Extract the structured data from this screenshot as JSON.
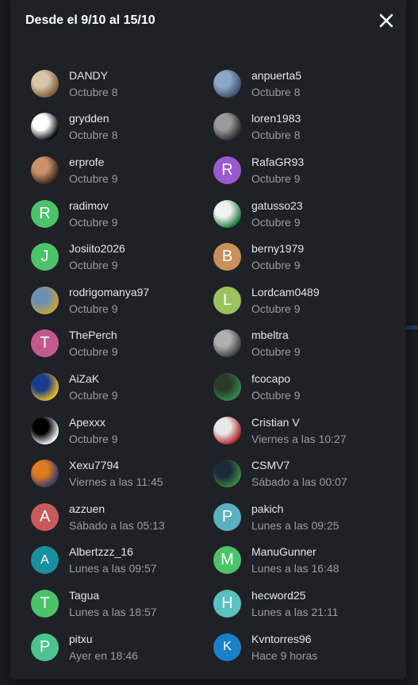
{
  "modal": {
    "title": "Desde el 9/10 al 15/10",
    "close_icon": "close-icon"
  },
  "users": [
    {
      "name": "DANDY",
      "date": "Octubre 8",
      "avatar": {
        "type": "photo",
        "colors": [
          "#d9c6a6",
          "#7a5a3a"
        ]
      }
    },
    {
      "name": "anpuerta5",
      "date": "Octubre 8",
      "avatar": {
        "type": "photo",
        "colors": [
          "#8fa6c4",
          "#3a4f70"
        ]
      }
    },
    {
      "name": "grydden",
      "date": "Octubre 8",
      "avatar": {
        "type": "photo",
        "colors": [
          "#ffffff",
          "#000000"
        ]
      }
    },
    {
      "name": "loren1983",
      "date": "Octubre 8",
      "avatar": {
        "type": "photo",
        "colors": [
          "#9a9a9a",
          "#2a2a2a"
        ]
      }
    },
    {
      "name": "erprofe",
      "date": "Octubre 9",
      "avatar": {
        "type": "photo",
        "colors": [
          "#c9906a",
          "#3a2518"
        ]
      }
    },
    {
      "name": "RafaGR93",
      "date": "Octubre 9",
      "avatar": {
        "type": "letter",
        "letter": "R",
        "color": "#9b59d0"
      }
    },
    {
      "name": "radimov",
      "date": "Octubre 9",
      "avatar": {
        "type": "letter",
        "letter": "R",
        "color": "#4cc36a"
      }
    },
    {
      "name": "gatusso23",
      "date": "Octubre 9",
      "avatar": {
        "type": "photo",
        "colors": [
          "#f2f2f2",
          "#1a7a3a"
        ]
      }
    },
    {
      "name": "Josiito2026",
      "date": "Octubre 9",
      "avatar": {
        "type": "letter",
        "letter": "J",
        "color": "#4cc36a"
      }
    },
    {
      "name": "berny1979",
      "date": "Octubre 9",
      "avatar": {
        "type": "letter",
        "letter": "B",
        "color": "#c9905a"
      }
    },
    {
      "name": "rodrigomanya97",
      "date": "Octubre 9",
      "avatar": {
        "type": "photo",
        "colors": [
          "#6f8fb0",
          "#c8a43a"
        ]
      }
    },
    {
      "name": "Lordcam0489",
      "date": "Octubre 9",
      "avatar": {
        "type": "letter",
        "letter": "L",
        "color": "#9ac35a"
      }
    },
    {
      "name": "ThePerch",
      "date": "Octubre 9",
      "avatar": {
        "type": "letter",
        "letter": "T",
        "color": "#c35a8f"
      }
    },
    {
      "name": "mbeltra",
      "date": "Octubre 9",
      "avatar": {
        "type": "photo",
        "colors": [
          "#b0b0b0",
          "#3a3a3a"
        ]
      }
    },
    {
      "name": "AiZaK",
      "date": "Octubre 9",
      "avatar": {
        "type": "photo",
        "colors": [
          "#1a3a8a",
          "#f0c020"
        ]
      }
    },
    {
      "name": "fcocapo",
      "date": "Octubre 9",
      "avatar": {
        "type": "photo",
        "colors": [
          "#2a3a2a",
          "#2e8a4a"
        ]
      }
    },
    {
      "name": "Apexxx",
      "date": "Octubre 9",
      "avatar": {
        "type": "photo",
        "colors": [
          "#000000",
          "#ffffff"
        ]
      }
    },
    {
      "name": "Cristian V",
      "date": "Viernes a las 10:27",
      "avatar": {
        "type": "photo",
        "colors": [
          "#e8e8e8",
          "#b02020"
        ]
      }
    },
    {
      "name": "Xexu7794",
      "date": "Viernes a las 11:45",
      "avatar": {
        "type": "photo",
        "colors": [
          "#e07a20",
          "#2a3a6a"
        ]
      }
    },
    {
      "name": "CSMV7",
      "date": "Sábado a las 00:07",
      "avatar": {
        "type": "photo",
        "colors": [
          "#1a2a3a",
          "#3a8a3a"
        ]
      }
    },
    {
      "name": "azzuen",
      "date": "Sábado a las 05:13",
      "avatar": {
        "type": "letter",
        "letter": "A",
        "color": "#c95a5a"
      }
    },
    {
      "name": "pakich",
      "date": "Lunes a las 09:25",
      "avatar": {
        "type": "letter",
        "letter": "P",
        "color": "#5ab0c0"
      }
    },
    {
      "name": "Albertzzz_16",
      "date": "Lunes a las 09:57",
      "avatar": {
        "type": "letter",
        "letter": "A",
        "color": "#1a8fa0",
        "small": true
      }
    },
    {
      "name": "ManuGunner",
      "date": "Lunes a las 16:48",
      "avatar": {
        "type": "letter",
        "letter": "M",
        "color": "#4cc36a"
      }
    },
    {
      "name": "Tagua",
      "date": "Lunes a las 18:57",
      "avatar": {
        "type": "letter",
        "letter": "T",
        "color": "#4cc36a"
      }
    },
    {
      "name": "hecword25",
      "date": "Lunes a las 21:11",
      "avatar": {
        "type": "letter",
        "letter": "H",
        "color": "#5ac0c0"
      }
    },
    {
      "name": "pitxu",
      "date": "Ayer en 18:46",
      "avatar": {
        "type": "letter",
        "letter": "P",
        "color": "#4cc38f"
      }
    },
    {
      "name": "Kvntorres96",
      "date": "Hace 9 horas",
      "avatar": {
        "type": "letter",
        "letter": "K",
        "color": "#1a80c9",
        "small": true
      }
    }
  ]
}
